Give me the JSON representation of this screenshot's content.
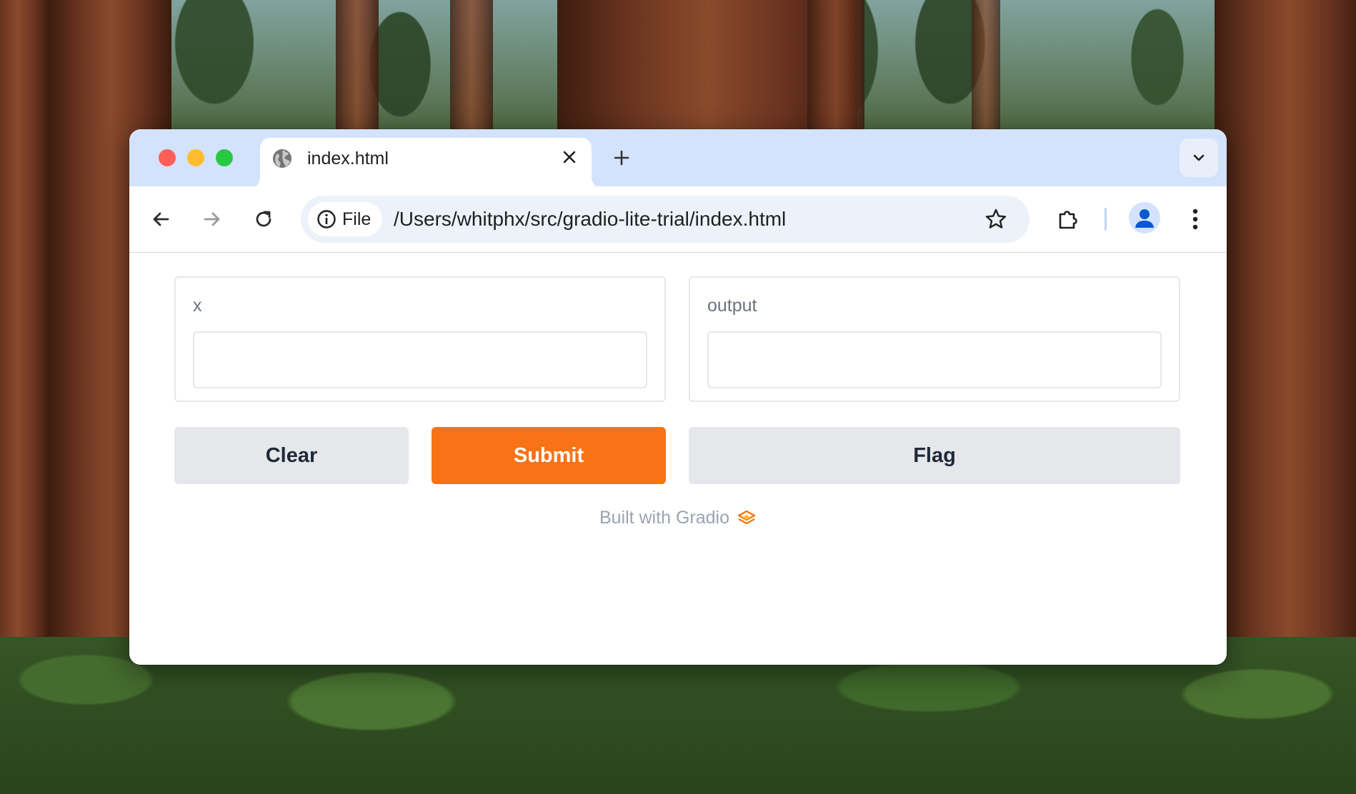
{
  "browser": {
    "tab": {
      "title": "index.html"
    },
    "address_bar": {
      "chip_label": "File",
      "url": "/Users/whitphx/src/gradio-lite-trial/index.html"
    }
  },
  "app": {
    "input": {
      "label": "x",
      "value": ""
    },
    "output": {
      "label": "output",
      "value": ""
    },
    "buttons": {
      "clear": "Clear",
      "submit": "Submit",
      "flag": "Flag"
    },
    "footer": "Built with Gradio"
  },
  "colors": {
    "accent": "#f97316",
    "secondary_button": "#e5e7eb",
    "tabstrip": "#d3e3fd"
  },
  "icons": {
    "tab": "globe-icon",
    "close": "close-icon",
    "new_tab": "plus-icon",
    "tab_search": "chevron-down-icon",
    "back": "arrow-left-icon",
    "forward": "arrow-right-icon",
    "reload": "reload-icon",
    "site_info": "info-icon",
    "bookmark": "star-icon",
    "extensions": "puzzle-icon",
    "profile": "person-icon",
    "menu": "kebab-icon",
    "brand": "gradio-logo-icon"
  }
}
